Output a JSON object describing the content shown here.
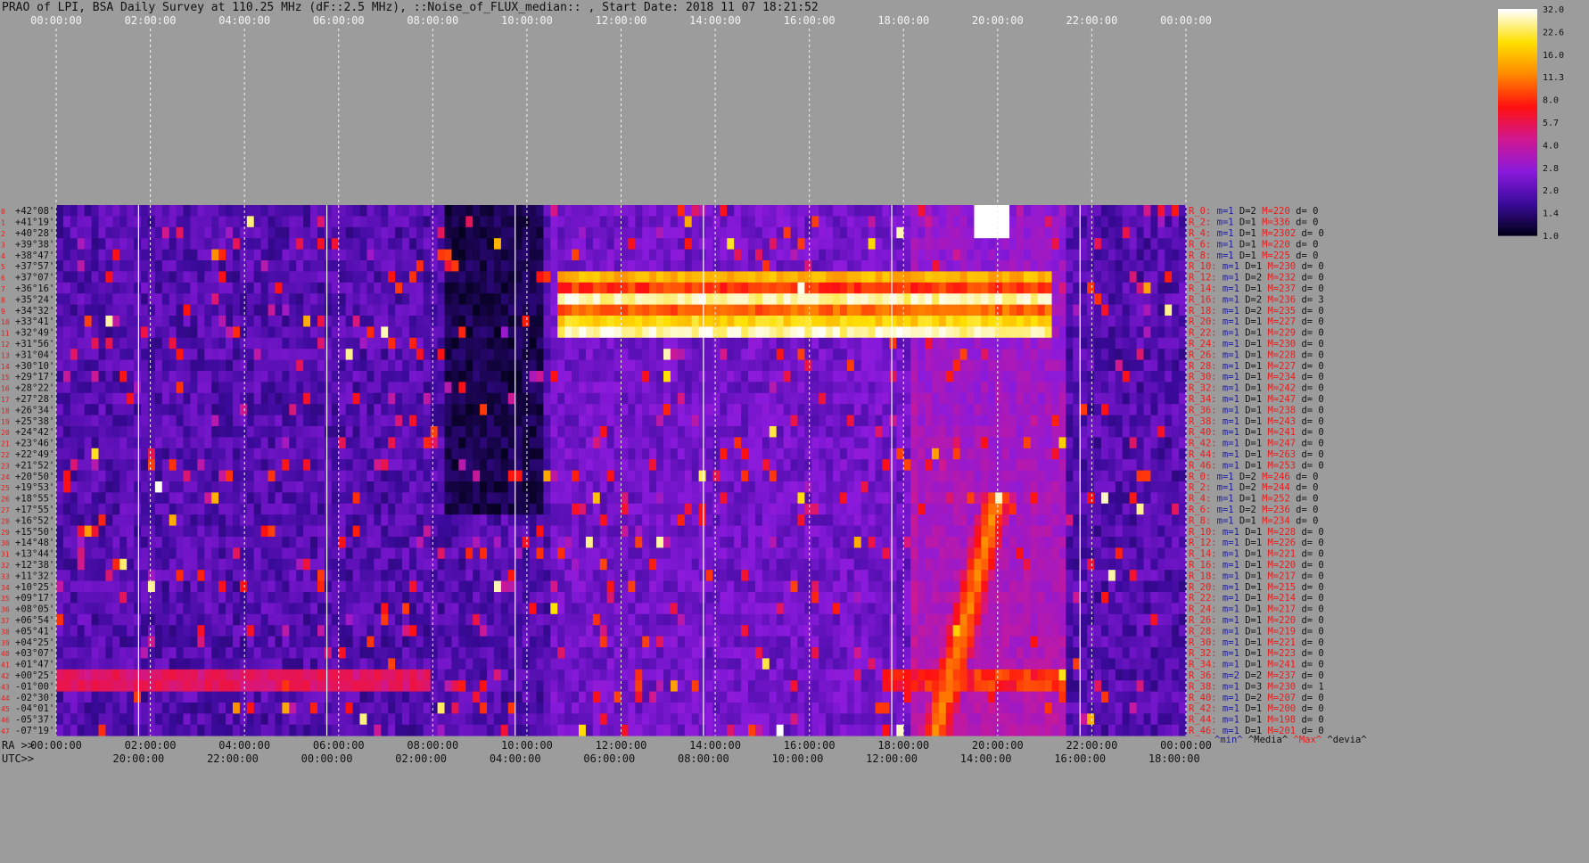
{
  "title": "PRAO of LPI, BSA Daily Survey at 110.25 MHz (dF::2.5 MHz), ::Noise_of_FLUX_median:: , Start Date: 2018 11 07 18:21:52",
  "chart_data": {
    "type": "heatmap",
    "top_time_ticks": [
      "00:00:00",
      "02:00:00",
      "04:00:00",
      "06:00:00",
      "08:00:00",
      "10:00:00",
      "12:00:00",
      "14:00:00",
      "16:00:00",
      "18:00:00",
      "20:00:00",
      "22:00:00",
      "00:00:00"
    ],
    "ra_axis_label": "RA >>",
    "ra_ticks": [
      "00:00:00",
      "02:00:00",
      "04:00:00",
      "06:00:00",
      "08:00:00",
      "10:00:00",
      "12:00:00",
      "14:00:00",
      "16:00:00",
      "18:00:00",
      "20:00:00",
      "22:00:00",
      "00:00:00"
    ],
    "utc_axis_label": "UTC>>",
    "utc_ticks": [
      "20:00:00",
      "22:00:00",
      "00:00:00",
      "02:00:00",
      "04:00:00",
      "06:00:00",
      "08:00:00",
      "10:00:00",
      "12:00:00",
      "14:00:00",
      "16:00:00",
      "18:00:00"
    ],
    "declinations": [
      "+42°08'",
      "+41°19'",
      "+40°28'",
      "+39°38'",
      "+38°47'",
      "+37°57'",
      "+37°07'",
      "+36°16'",
      "+35°24'",
      "+34°32'",
      "+33°41'",
      "+32°49'",
      "+31°56'",
      "+31°04'",
      "+30°10'",
      "+29°17'",
      "+28°22'",
      "+27°28'",
      "+26°34'",
      "+25°38'",
      "+24°42'",
      "+23°46'",
      "+22°49'",
      "+21°52'",
      "+20°50'",
      "+19°53'",
      "+18°55'",
      "+17°55'",
      "+16°52'",
      "+15°50'",
      "+14°48'",
      "+13°44'",
      "+12°38'",
      "+11°32'",
      "+10°25'",
      "+09°17'",
      "+08°05'",
      "+06°54'",
      "+05°41'",
      "+04°25'",
      "+03°07'",
      "+01°47'",
      "+00°25'",
      "-01°00'",
      "-02°30'",
      "-04°01'",
      "-05°37'",
      "-07°19'"
    ],
    "beam_numbers": [
      "0",
      "1",
      "2",
      "3",
      "4",
      "5",
      "6",
      "7",
      "8",
      "9",
      "10",
      "11",
      "12",
      "13",
      "14",
      "15",
      "16",
      "17",
      "18",
      "19",
      "20",
      "21",
      "22",
      "23",
      "24",
      "25",
      "26",
      "27",
      "28",
      "29",
      "30",
      "31",
      "32",
      "33",
      "34",
      "35",
      "36",
      "37",
      "38",
      "39",
      "40",
      "41",
      "42",
      "43",
      "44",
      "45",
      "46",
      "47"
    ],
    "stats_rows": [
      {
        "r": "R_0:",
        "m": "m=1",
        "d": "D=2",
        "M": "M=220",
        "dv": "d= 0"
      },
      {
        "r": "R_2:",
        "m": "m=1",
        "d": "D=1",
        "M": "M=336",
        "dv": "d= 0"
      },
      {
        "r": "R_4:",
        "m": "m=1",
        "d": "D=1",
        "M": "M=2302",
        "dv": "d= 0"
      },
      {
        "r": "R_6:",
        "m": "m=1",
        "d": "D=1",
        "M": "M=220",
        "dv": "d= 0"
      },
      {
        "r": "R_8:",
        "m": "m=1",
        "d": "D=1",
        "M": "M=225",
        "dv": "d= 0"
      },
      {
        "r": "R_10:",
        "m": "m=1",
        "d": "D=1",
        "M": "M=230",
        "dv": "d= 0"
      },
      {
        "r": "R_12:",
        "m": "m=1",
        "d": "D=2",
        "M": "M=232",
        "dv": "d= 0"
      },
      {
        "r": "R_14:",
        "m": "m=1",
        "d": "D=1",
        "M": "M=237",
        "dv": "d= 0"
      },
      {
        "r": "R_16:",
        "m": "m=1",
        "d": "D=2",
        "M": "M=236",
        "dv": "d= 3"
      },
      {
        "r": "R_18:",
        "m": "m=1",
        "d": "D=2",
        "M": "M=235",
        "dv": "d= 0"
      },
      {
        "r": "R_20:",
        "m": "m=1",
        "d": "D=1",
        "M": "M=227",
        "dv": "d= 0"
      },
      {
        "r": "R_22:",
        "m": "m=1",
        "d": "D=1",
        "M": "M=229",
        "dv": "d= 0"
      },
      {
        "r": "R_24:",
        "m": "m=1",
        "d": "D=1",
        "M": "M=230",
        "dv": "d= 0"
      },
      {
        "r": "R_26:",
        "m": "m=1",
        "d": "D=1",
        "M": "M=228",
        "dv": "d= 0"
      },
      {
        "r": "R_28:",
        "m": "m=1",
        "d": "D=1",
        "M": "M=227",
        "dv": "d= 0"
      },
      {
        "r": "R_30:",
        "m": "m=1",
        "d": "D=1",
        "M": "M=234",
        "dv": "d= 0"
      },
      {
        "r": "R_32:",
        "m": "m=1",
        "d": "D=1",
        "M": "M=242",
        "dv": "d= 0"
      },
      {
        "r": "R_34:",
        "m": "m=1",
        "d": "D=1",
        "M": "M=247",
        "dv": "d= 0"
      },
      {
        "r": "R_36:",
        "m": "m=1",
        "d": "D=1",
        "M": "M=238",
        "dv": "d= 0"
      },
      {
        "r": "R_38:",
        "m": "m=1",
        "d": "D=1",
        "M": "M=243",
        "dv": "d= 0"
      },
      {
        "r": "R_40:",
        "m": "m=1",
        "d": "D=1",
        "M": "M=241",
        "dv": "d= 0"
      },
      {
        "r": "R_42:",
        "m": "m=1",
        "d": "D=1",
        "M": "M=247",
        "dv": "d= 0"
      },
      {
        "r": "R_44:",
        "m": "m=1",
        "d": "D=1",
        "M": "M=263",
        "dv": "d= 0"
      },
      {
        "r": "R_46:",
        "m": "m=1",
        "d": "D=1",
        "M": "M=253",
        "dv": "d= 0"
      },
      {
        "r": "R_0:",
        "m": "m=1",
        "d": "D=2",
        "M": "M=246",
        "dv": "d= 0"
      },
      {
        "r": "R_2:",
        "m": "m=1",
        "d": "D=2",
        "M": "M=244",
        "dv": "d= 0"
      },
      {
        "r": "R_4:",
        "m": "m=1",
        "d": "D=1",
        "M": "M=252",
        "dv": "d= 0"
      },
      {
        "r": "R_6:",
        "m": "m=1",
        "d": "D=2",
        "M": "M=236",
        "dv": "d= 0"
      },
      {
        "r": "R_8:",
        "m": "m=1",
        "d": "D=1",
        "M": "M=234",
        "dv": "d= 0"
      },
      {
        "r": "R_10:",
        "m": "m=1",
        "d": "D=1",
        "M": "M=228",
        "dv": "d= 0"
      },
      {
        "r": "R_12:",
        "m": "m=1",
        "d": "D=1",
        "M": "M=226",
        "dv": "d= 0"
      },
      {
        "r": "R_14:",
        "m": "m=1",
        "d": "D=1",
        "M": "M=221",
        "dv": "d= 0"
      },
      {
        "r": "R_16:",
        "m": "m=1",
        "d": "D=1",
        "M": "M=220",
        "dv": "d= 0"
      },
      {
        "r": "R_18:",
        "m": "m=1",
        "d": "D=1",
        "M": "M=217",
        "dv": "d= 0"
      },
      {
        "r": "R_20:",
        "m": "m=1",
        "d": "D=1",
        "M": "M=215",
        "dv": "d= 0"
      },
      {
        "r": "R_22:",
        "m": "m=1",
        "d": "D=1",
        "M": "M=214",
        "dv": "d= 0"
      },
      {
        "r": "R_24:",
        "m": "m=1",
        "d": "D=1",
        "M": "M=217",
        "dv": "d= 0"
      },
      {
        "r": "R_26:",
        "m": "m=1",
        "d": "D=1",
        "M": "M=220",
        "dv": "d= 0"
      },
      {
        "r": "R_28:",
        "m": "m=1",
        "d": "D=1",
        "M": "M=219",
        "dv": "d= 0"
      },
      {
        "r": "R_30:",
        "m": "m=1",
        "d": "D=1",
        "M": "M=221",
        "dv": "d= 0"
      },
      {
        "r": "R_32:",
        "m": "m=1",
        "d": "D=1",
        "M": "M=223",
        "dv": "d= 0"
      },
      {
        "r": "R_34:",
        "m": "m=1",
        "d": "D=1",
        "M": "M=241",
        "dv": "d= 0"
      },
      {
        "r": "R_36:",
        "m": "m=2",
        "d": "D=2",
        "M": "M=237",
        "dv": "d= 0"
      },
      {
        "r": "R_38:",
        "m": "m=1",
        "d": "D=3",
        "M": "M=230",
        "dv": "d= 1"
      },
      {
        "r": "R_40:",
        "m": "m=1",
        "d": "D=2",
        "M": "M=207",
        "dv": "d= 0"
      },
      {
        "r": "R_42:",
        "m": "m=1",
        "d": "D=1",
        "M": "M=200",
        "dv": "d= 0"
      },
      {
        "r": "R_44:",
        "m": "m=1",
        "d": "D=1",
        "M": "M=198",
        "dv": "d= 0"
      },
      {
        "r": "R_46:",
        "m": "m=1",
        "d": "D=1",
        "M": "M=201",
        "dv": "d= 0"
      }
    ],
    "stats_legend": {
      "min": "^min^",
      "median": "^Media^",
      "max": "^Max^",
      "dev": "^devia^"
    },
    "colorbar": {
      "ticks": [
        "32.0",
        "22.6",
        "16.0",
        "11.3",
        "8.0",
        "5.7",
        "4.0",
        "2.8",
        "2.0",
        "1.4",
        "1.0"
      ],
      "vmin": 1.0,
      "vmax": 32.0,
      "scale": "log",
      "colors": [
        "#000014",
        "#3a0a9a",
        "#8a1adc",
        "#d01890",
        "#ff1010",
        "#ff8800",
        "#ffe000",
        "#ffffff"
      ]
    },
    "features": [
      {
        "type": "hband",
        "label": "interference bands, RA 10:40-21:10, Dec +37°07' to +31°56'",
        "rows": [
          6,
          7,
          8,
          9,
          10,
          11
        ],
        "ra_start": 10.6,
        "ra_end": 21.1,
        "level": [
          18,
          10,
          32,
          12,
          22,
          32
        ]
      },
      {
        "type": "source",
        "label": "bright source near RA 19:53, Dec +42°08' to +40°28'",
        "ra": 19.9,
        "row": 1,
        "level": 32
      },
      {
        "type": "diagonal",
        "label": "Sun track",
        "ra_start": 18.7,
        "row_start": 47,
        "ra_end": 20.0,
        "row_end": 26,
        "level": 11
      },
      {
        "type": "band",
        "label": "galactic plane Dec -01°00'",
        "rows": [
          42,
          43
        ],
        "ra_start": 0.0,
        "ra_end": 8.0,
        "level": 4.5
      }
    ],
    "xlim_hours": [
      0,
      24
    ]
  }
}
